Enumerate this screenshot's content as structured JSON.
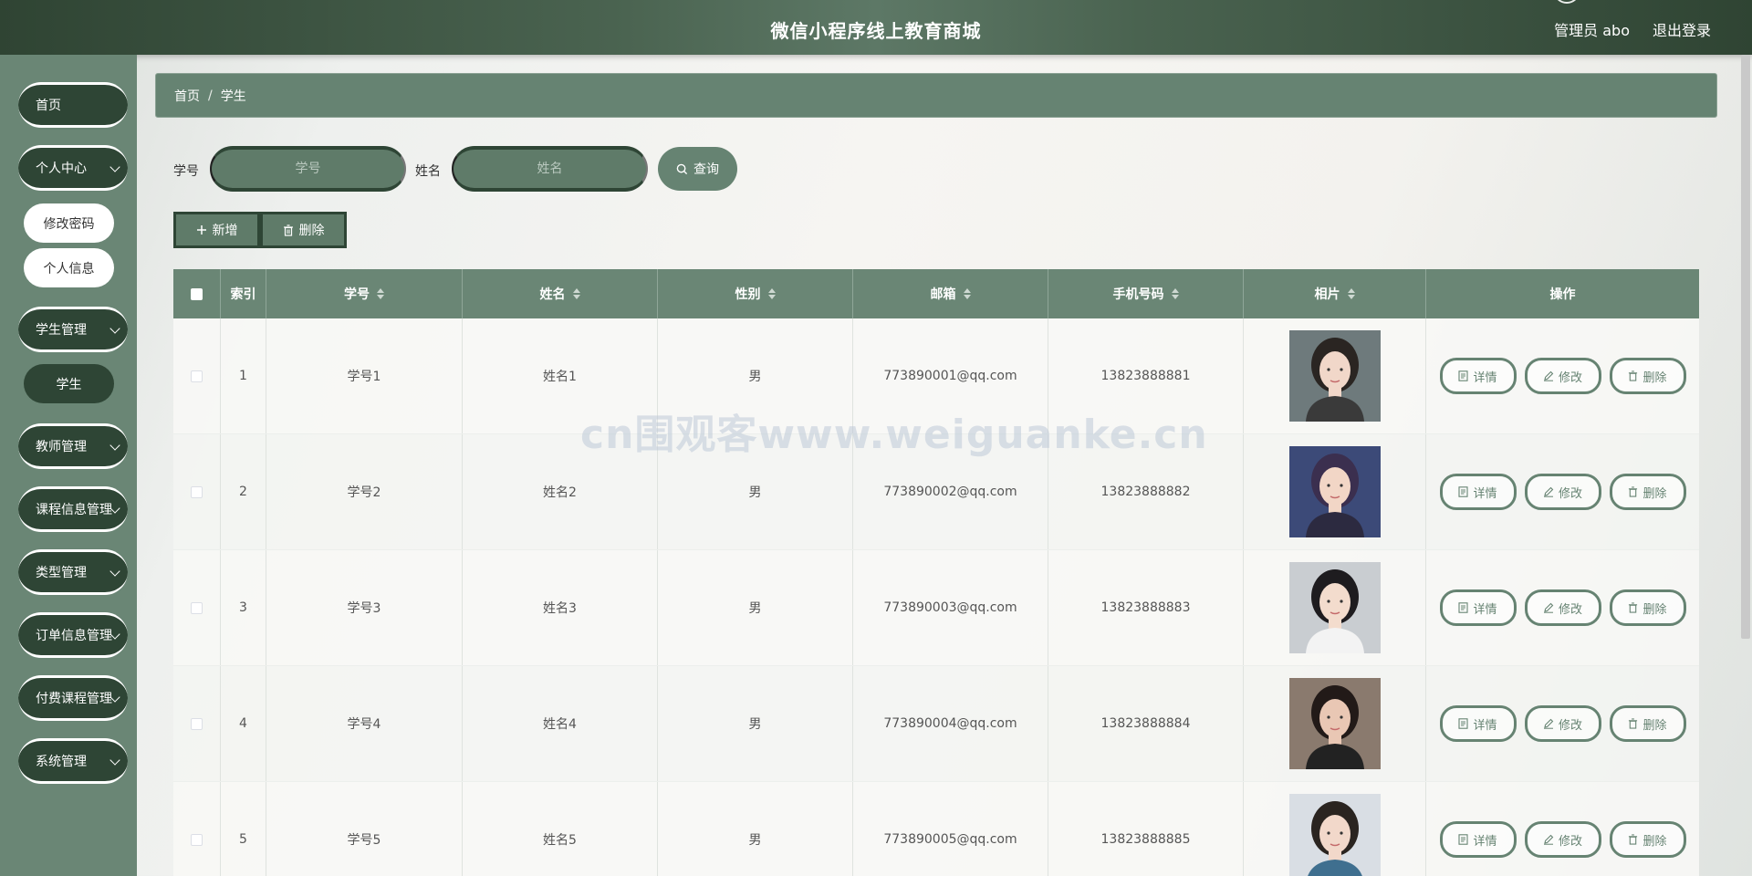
{
  "header": {
    "title": "微信小程序线上教育商城",
    "user": "管理员 abo",
    "logout": "退出登录"
  },
  "sidebar": {
    "items": [
      {
        "label": "首页"
      },
      {
        "label": "个人中心",
        "sub": [
          "修改密码",
          "个人信息"
        ]
      },
      {
        "label": "学生管理",
        "sub": [
          "学生"
        ]
      },
      {
        "label": "教师管理"
      },
      {
        "label": "课程信息管理"
      },
      {
        "label": "类型管理"
      },
      {
        "label": "订单信息管理"
      },
      {
        "label": "付费课程管理"
      },
      {
        "label": "系统管理"
      }
    ]
  },
  "breadcrumb": {
    "home": "首页",
    "sep": "/",
    "current": "学生"
  },
  "search": {
    "id_label": "学号",
    "id_placeholder": "学号",
    "name_label": "姓名",
    "name_placeholder": "姓名",
    "query": "查询"
  },
  "actions": {
    "add": "新增",
    "delete": "删除"
  },
  "table": {
    "headers": [
      "索引",
      "学号",
      "姓名",
      "性别",
      "邮箱",
      "手机号码",
      "相片",
      "操作"
    ],
    "rows": [
      {
        "index": "1",
        "id": "学号1",
        "name": "姓名1",
        "gender": "男",
        "email": "773890001@qq.com",
        "phone": "13823888881"
      },
      {
        "index": "2",
        "id": "学号2",
        "name": "姓名2",
        "gender": "男",
        "email": "773890002@qq.com",
        "phone": "13823888882"
      },
      {
        "index": "3",
        "id": "学号3",
        "name": "姓名3",
        "gender": "男",
        "email": "773890003@qq.com",
        "phone": "13823888883"
      },
      {
        "index": "4",
        "id": "学号4",
        "name": "姓名4",
        "gender": "男",
        "email": "773890004@qq.com",
        "phone": "13823888884"
      },
      {
        "index": "5",
        "id": "学号5",
        "name": "姓名5",
        "gender": "男",
        "email": "773890005@qq.com",
        "phone": "13823888885"
      }
    ],
    "ops": {
      "detail": "详情",
      "edit": "修改",
      "delete": "删除"
    }
  },
  "watermark": "cn围观客www.weiguanke.cn",
  "colors": {
    "primary": "#668372",
    "dark": "#2e4535",
    "sidebar": "#6a8675"
  }
}
